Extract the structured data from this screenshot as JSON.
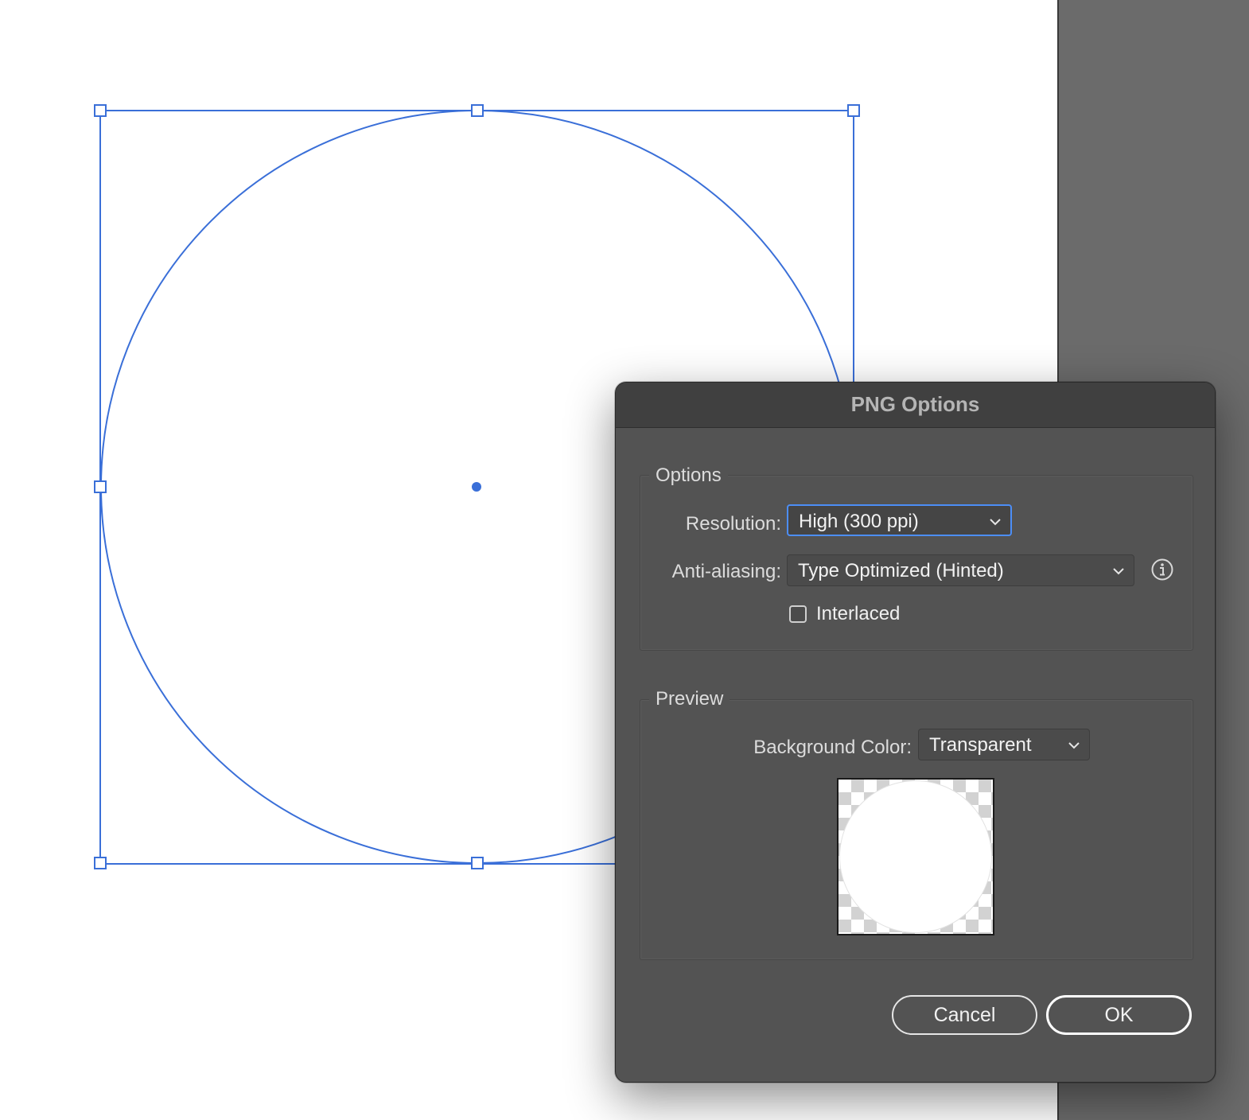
{
  "dialog": {
    "title": "PNG Options",
    "options_group": {
      "title": "Options",
      "resolution_label": "Resolution:",
      "resolution_value": "High (300 ppi)",
      "antialiasing_label": "Anti-aliasing:",
      "antialiasing_value": "Type Optimized (Hinted)",
      "interlaced_label": "Interlaced",
      "interlaced_checked": false
    },
    "preview_group": {
      "title": "Preview",
      "bg_color_label": "Background Color:",
      "bg_color_value": "Transparent"
    },
    "buttons": {
      "cancel": "Cancel",
      "ok": "OK"
    }
  },
  "colors": {
    "selection_blue": "#3a6fd8",
    "dialog_bg": "#535353",
    "pasteboard": "#6b6b6b"
  },
  "icons": {
    "info": "info-icon",
    "chevron": "chevron-down-icon"
  }
}
